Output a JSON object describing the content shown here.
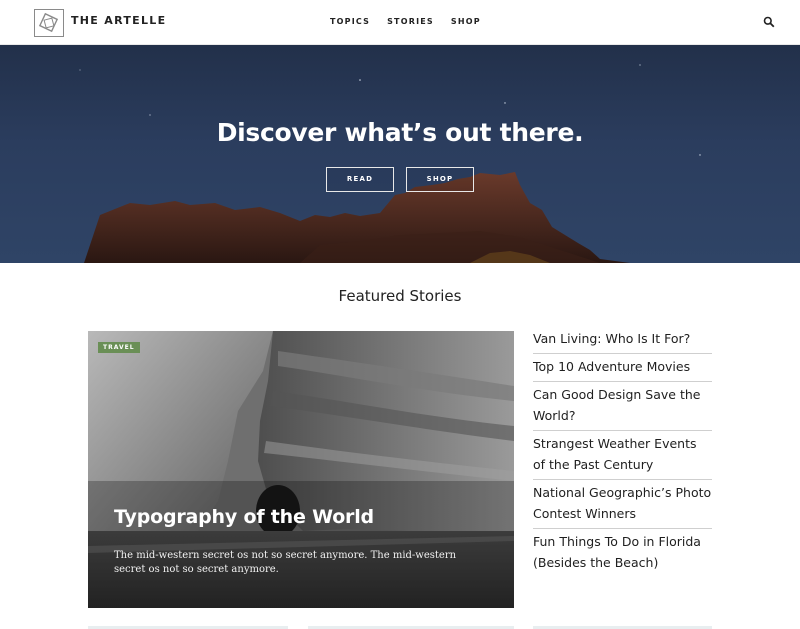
{
  "header": {
    "brand": "THE ARTELLE",
    "nav": [
      "TOPICS",
      "STORIES",
      "SHOP"
    ],
    "search_icon": "search-icon"
  },
  "hero": {
    "title": "Discover what’s out there.",
    "buttons": {
      "read": "READ",
      "shop": "SHOP"
    }
  },
  "featured": {
    "heading": "Featured Stories",
    "main_card": {
      "tag": "TRAVEL",
      "title": "Typography of the World",
      "description": "The mid-western secret os not so secret anymore. The mid-western secret os not so secret anymore."
    },
    "list": [
      "Van Living: Who Is It For?",
      "Top 10 Adventure Movies",
      "Can Good Design Save the World?",
      "Strangest Weather Events of the Past Century",
      "National Geographic’s Photo Contest Winners",
      "Fun Things To Do in Florida (Besides the Beach)"
    ]
  },
  "colors": {
    "tag_green": "#6a8f56",
    "hero_sky": "#2b3d5e",
    "rock": "#4a2a20"
  }
}
